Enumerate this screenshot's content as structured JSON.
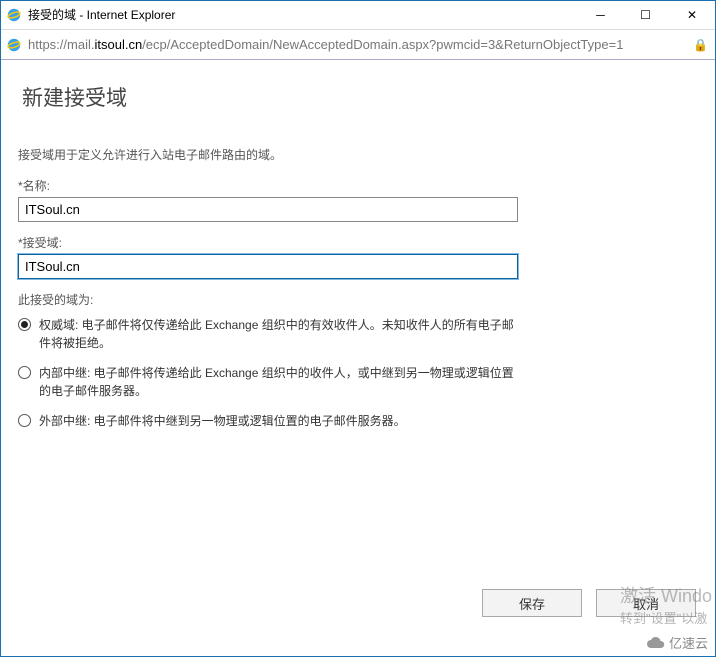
{
  "window": {
    "title": "接受的域 - Internet Explorer"
  },
  "address": {
    "scheme": "https://",
    "prefix": "mail.",
    "host": "itsoul.cn",
    "path": "/ecp/AcceptedDomain/NewAcceptedDomain.aspx?pwmcid=3&ReturnObjectType=1"
  },
  "page": {
    "heading": "新建接受域",
    "description": "接受域用于定义允许进行入站电子邮件路由的域。",
    "name_label": "*名称:",
    "name_value": "ITSoul.cn",
    "domain_label": "*接受域:",
    "domain_value": "ITSoul.cn",
    "type_label": "此接受的域为:",
    "radios": [
      {
        "label": "权威域: 电子邮件将仅传递给此 Exchange 组织中的有效收件人。未知收件人的所有电子邮件将被拒绝。",
        "checked": true
      },
      {
        "label": "内部中继: 电子邮件将传递给此 Exchange 组织中的收件人，或中继到另一物理或逻辑位置的电子邮件服务器。",
        "checked": false
      },
      {
        "label": "外部中继: 电子邮件将中继到另一物理或逻辑位置的电子邮件服务器。",
        "checked": false
      }
    ],
    "save_label": "保存",
    "cancel_label": "取消"
  },
  "watermark": {
    "line1": "激活 Windo",
    "line2": "转到\"设置\"以激"
  },
  "brand": "亿速云"
}
